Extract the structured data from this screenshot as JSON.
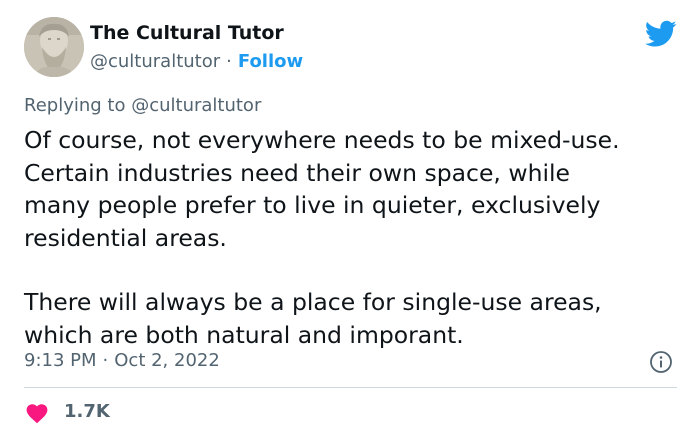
{
  "author": {
    "name": "The Cultural Tutor",
    "handle": "@culturaltutor",
    "separator": "·",
    "follow_label": "Follow"
  },
  "reply": {
    "prefix": "Replying to ",
    "mention": "@culturaltutor"
  },
  "tweet": {
    "paragraphs": [
      "Of course, not everywhere needs to be mixed-use.\nCertain industries need their own space, while\nmany people prefer to live in quieter, exclusively\nresidential areas.",
      "There will always be a place for single-use areas,\nwhich are both natural and imporant."
    ],
    "time": "9:13 PM",
    "separator": "·",
    "date": "Oct 2, 2022",
    "likes": "1.7K"
  },
  "icons": {
    "brand": "twitter-bird-icon",
    "info": "info-icon",
    "like": "heart-icon"
  },
  "colors": {
    "accent": "#1d9bf0",
    "like": "#f91880",
    "text": "#0f1419",
    "muted": "#536471",
    "divider": "#cfd9de"
  }
}
